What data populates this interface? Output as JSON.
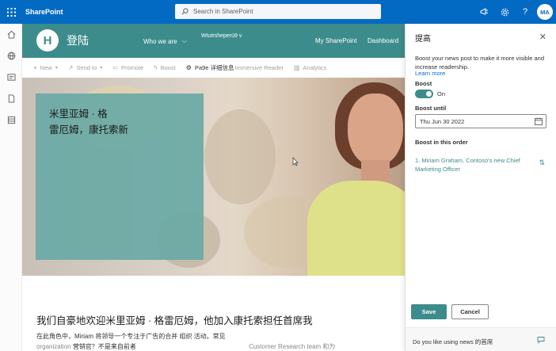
{
  "suite": {
    "app_name": "SharePoint",
    "search_placeholder": "Search in SharePoint",
    "avatar_initials": "MA"
  },
  "site": {
    "title": "登陆",
    "nav": {
      "who_we_are": "Who we are",
      "wtutr": "Wtutrsheperü9 v",
      "my_sharepoint": "My SharePoint",
      "dashboard": "Dashboard"
    }
  },
  "commandbar": {
    "new": "New",
    "send_to": "Send to",
    "promote": "Promote",
    "boost": "Boost",
    "page_details": "Pa9e 详细信息",
    "immersive_reader": "Immersive Reader",
    "analytics": "Analytics"
  },
  "hero": {
    "title_line1": "米里亚姆 · 格",
    "title_line2": "雷厄姆，康托索新"
  },
  "article": {
    "heading": "我们自豪地欢迎米里亚姆 · 格雷厄姆，他加入康托索担任首席我",
    "para_line1": "在此角色中，Miriam 将领导一个专注于广告的合并 组织 活动。常见",
    "para_line2a": "organization",
    "para_line2b": "营销官？不是来自前者",
    "para_line2c": "Customer Research team 和为"
  },
  "panel": {
    "title": "提高",
    "description": "Boost your news post to make it more visible and increase readership.",
    "learn_more": "Learn more",
    "boost_label": "Boost",
    "toggle_state": "On",
    "boost_until_label": "Boost until",
    "boost_until_value": "Thu Jun 30 2022",
    "order_label": "Boost in this order",
    "order_item": "1. Miriam Graham, Contoso's new Chief Marketing Officer",
    "save": "Save",
    "cancel": "Cancel",
    "feedback": "Do you like using news 的首席"
  },
  "colors": {
    "suite_blue": "#036ac4",
    "site_teal": "#3d8c8c",
    "hero_box_teal": "#6aa9a5"
  }
}
